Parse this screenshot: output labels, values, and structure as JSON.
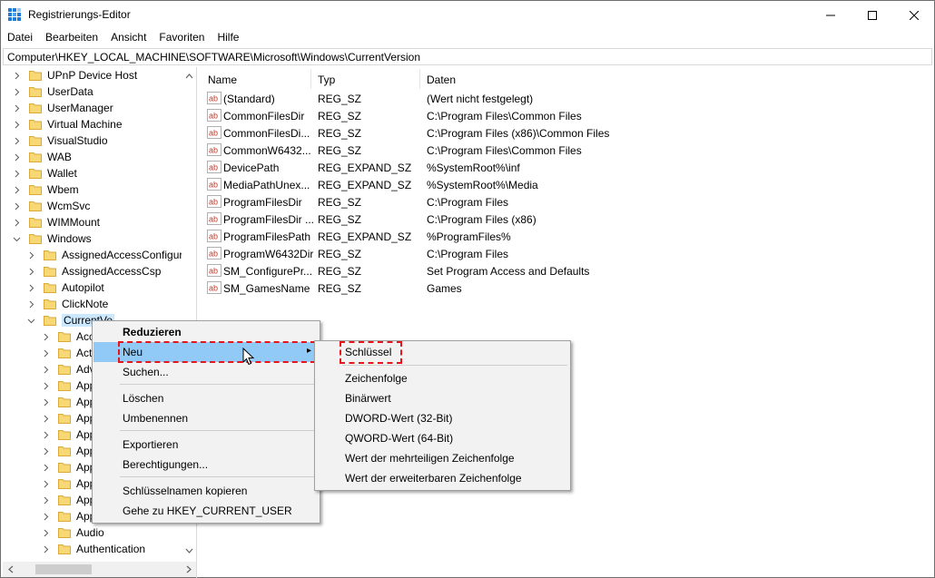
{
  "window": {
    "title": "Registrierungs-Editor"
  },
  "menubar": {
    "items": [
      "Datei",
      "Bearbeiten",
      "Ansicht",
      "Favoriten",
      "Hilfe"
    ]
  },
  "address": {
    "path": "Computer\\HKEY_LOCAL_MACHINE\\SOFTWARE\\Microsoft\\Windows\\CurrentVersion"
  },
  "tree": {
    "items": [
      {
        "label": "UPnP Device Host"
      },
      {
        "label": "UserData"
      },
      {
        "label": "UserManager"
      },
      {
        "label": "Virtual Machine"
      },
      {
        "label": "VisualStudio"
      },
      {
        "label": "WAB"
      },
      {
        "label": "Wallet"
      },
      {
        "label": "Wbem"
      },
      {
        "label": "WcmSvc"
      },
      {
        "label": "WIMMount"
      },
      {
        "label": "Windows"
      },
      {
        "label": "AssignedAccessConfigura"
      },
      {
        "label": "AssignedAccessCsp"
      },
      {
        "label": "Autopilot"
      },
      {
        "label": "ClickNote"
      },
      {
        "label": "CurrentVe"
      },
      {
        "label": "Acc"
      },
      {
        "label": "Acti"
      },
      {
        "label": "Adv"
      },
      {
        "label": "App"
      },
      {
        "label": "App"
      },
      {
        "label": "App"
      },
      {
        "label": "App"
      },
      {
        "label": "App"
      },
      {
        "label": "App"
      },
      {
        "label": "App"
      },
      {
        "label": "App"
      },
      {
        "label": "App"
      },
      {
        "label": "Audio"
      },
      {
        "label": "Authentication"
      }
    ]
  },
  "columns": {
    "name": "Name",
    "type": "Typ",
    "data": "Daten"
  },
  "values": [
    {
      "name": "(Standard)",
      "type": "REG_SZ",
      "data": "(Wert nicht festgelegt)"
    },
    {
      "name": "CommonFilesDir",
      "type": "REG_SZ",
      "data": "C:\\Program Files\\Common Files"
    },
    {
      "name": "CommonFilesDi...",
      "type": "REG_SZ",
      "data": "C:\\Program Files (x86)\\Common Files"
    },
    {
      "name": "CommonW6432...",
      "type": "REG_SZ",
      "data": "C:\\Program Files\\Common Files"
    },
    {
      "name": "DevicePath",
      "type": "REG_EXPAND_SZ",
      "data": "%SystemRoot%\\inf"
    },
    {
      "name": "MediaPathUnex...",
      "type": "REG_EXPAND_SZ",
      "data": "%SystemRoot%\\Media"
    },
    {
      "name": "ProgramFilesDir",
      "type": "REG_SZ",
      "data": "C:\\Program Files"
    },
    {
      "name": "ProgramFilesDir ...",
      "type": "REG_SZ",
      "data": "C:\\Program Files (x86)"
    },
    {
      "name": "ProgramFilesPath",
      "type": "REG_EXPAND_SZ",
      "data": "%ProgramFiles%"
    },
    {
      "name": "ProgramW6432Dir",
      "type": "REG_SZ",
      "data": "C:\\Program Files"
    },
    {
      "name": "SM_ConfigurePr...",
      "type": "REG_SZ",
      "data": "Set Program Access and Defaults"
    },
    {
      "name": "SM_GamesName",
      "type": "REG_SZ",
      "data": "Games"
    }
  ],
  "context_menu": {
    "collapse": "Reduzieren",
    "new": "Neu",
    "find": "Suchen...",
    "delete": "Löschen",
    "rename": "Umbenennen",
    "export": "Exportieren",
    "permissions": "Berechtigungen...",
    "copy_key_name": "Schlüsselnamen kopieren",
    "goto": "Gehe zu HKEY_CURRENT_USER"
  },
  "submenu": {
    "key": "Schlüssel",
    "string": "Zeichenfolge",
    "binary": "Binärwert",
    "dword": "DWORD-Wert (32-Bit)",
    "qword": "QWORD-Wert (64-Bit)",
    "multi_string": "Wert der mehrteiligen Zeichenfolge",
    "expand_string": "Wert der erweiterbaren Zeichenfolge"
  },
  "colors": {
    "selection": "#cce8ff",
    "menu_hover": "#91c9f7",
    "annotation": "#e8141b",
    "folder": "#f8d775"
  }
}
